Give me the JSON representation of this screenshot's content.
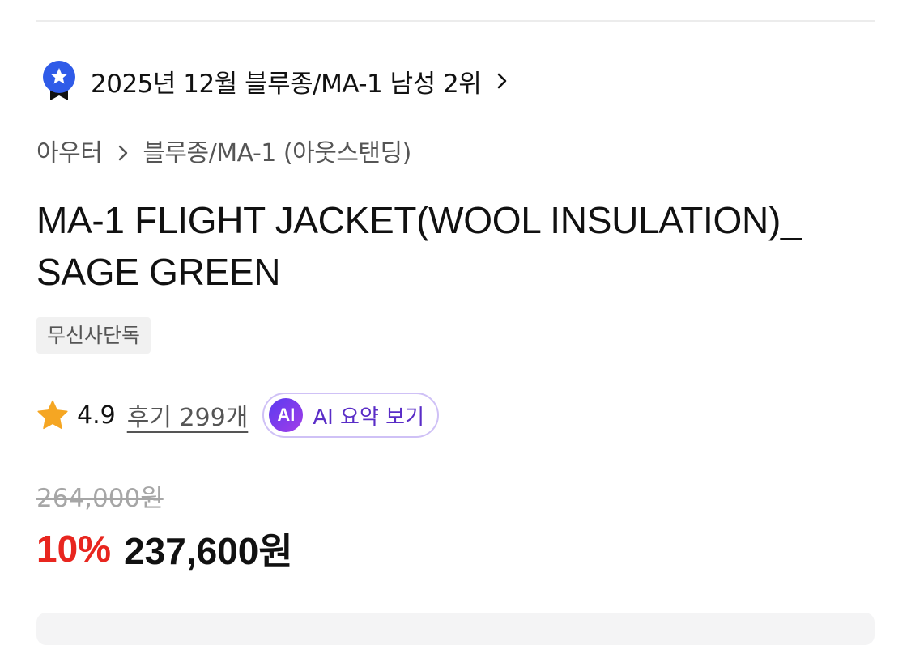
{
  "ranking": {
    "text": "2025년 12월 블루종/MA-1 남성 2위",
    "icon": "ranking-badge-icon",
    "color": "#2f5be8"
  },
  "breadcrumb": {
    "items": [
      "아우터",
      "블루종/MA-1 (아웃스탠딩)"
    ],
    "separator_icon": "chevron-right-icon"
  },
  "product": {
    "title": "MA-1 FLIGHT JACKET(WOOL INSULATION)_ SAGE GREEN",
    "tag": "무신사단독"
  },
  "rating": {
    "icon": "star-icon",
    "star_color": "#f5a623",
    "value": "4.9",
    "reviews_label": "후기 299개"
  },
  "ai_summary": {
    "logo_text": "AI",
    "label": "AI 요약 보기"
  },
  "price": {
    "original": "264,000원",
    "discount_rate": "10%",
    "sale": "237,600원",
    "discount_color": "#e8261f"
  }
}
